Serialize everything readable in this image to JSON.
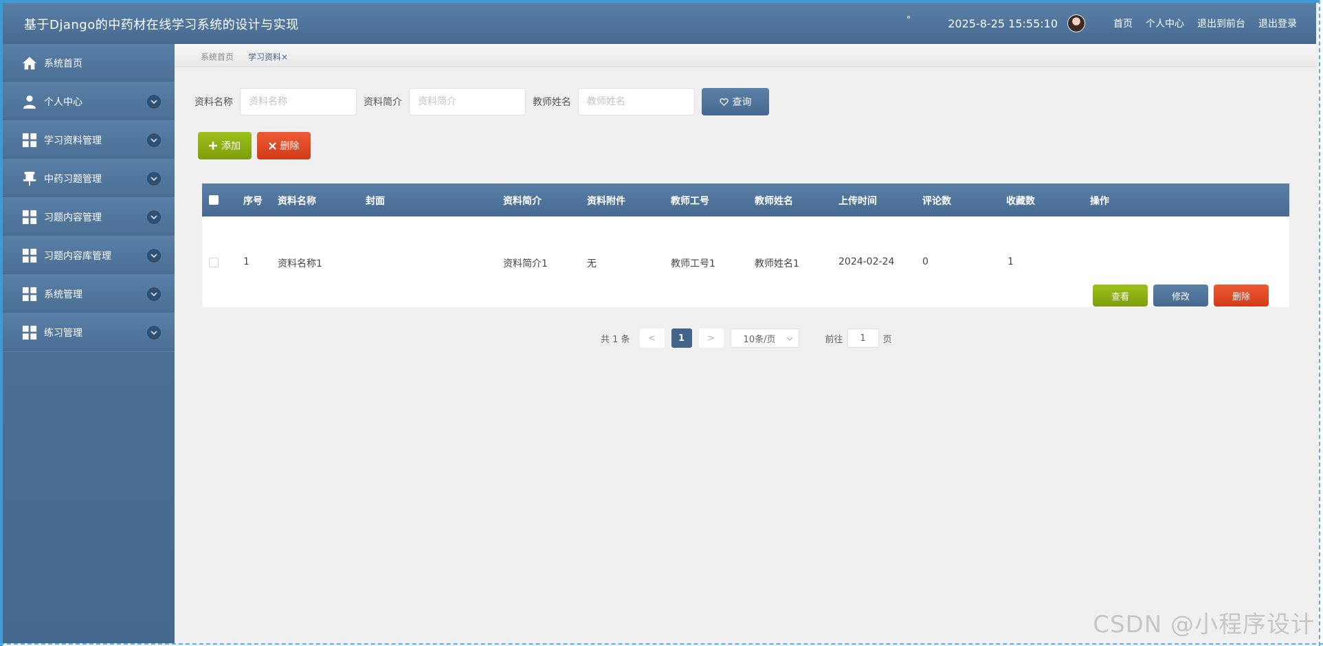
{
  "header": {
    "title": "基于Django的中药材在线学习系统的设计与实现",
    "degree": "°",
    "datetime": "2025-8-25 15:55:10",
    "links": [
      "首页",
      "个人中心",
      "退出到前台",
      "退出登录"
    ]
  },
  "sidebar": {
    "items": [
      {
        "label": "系统首页",
        "icon": "home-icon"
      },
      {
        "label": "个人中心",
        "icon": "person-icon"
      },
      {
        "label": "学习资料管理",
        "icon": "grid-icon"
      },
      {
        "label": "中药习题管理",
        "icon": "pin-icon"
      },
      {
        "label": "习题内容管理",
        "icon": "grid-icon"
      },
      {
        "label": "习题内容库管理",
        "icon": "grid-icon"
      },
      {
        "label": "系统管理",
        "icon": "grid-icon"
      },
      {
        "label": "练习管理",
        "icon": "grid-icon"
      }
    ]
  },
  "breadcrumb": {
    "home": "系统首页",
    "current": "学习资料",
    "close": "×"
  },
  "search": {
    "name_label": "资料名称",
    "name_placeholder": "资料名称",
    "intro_label": "资料简介",
    "intro_placeholder": "资料简介",
    "teacher_label": "教师姓名",
    "teacher_placeholder": "教师姓名",
    "query_label": "查询"
  },
  "actions": {
    "add_label": "添加",
    "delete_label": "删除"
  },
  "table": {
    "headers": [
      "序号",
      "资料名称",
      "封面",
      "资料简介",
      "资料附件",
      "教师工号",
      "教师姓名",
      "上传时间",
      "评论数",
      "收藏数",
      "操作"
    ],
    "rows": [
      {
        "index": "1",
        "name": "资料名称1",
        "cover": "",
        "intro": "资料简介1",
        "attachment": "无",
        "teacher_id": "教师工号1",
        "teacher_name": "教师姓名1",
        "upload_time": "2024-02-24",
        "comments": "0",
        "favorites": "1",
        "view_label": "查看",
        "edit_label": "修改",
        "delete_label": "删除"
      }
    ]
  },
  "pagination": {
    "total_text": "共 1 条",
    "prev": "<",
    "current_page": "1",
    "next": ">",
    "page_size": "10条/页",
    "goto_label": "前往",
    "goto_value": "1",
    "page_suffix": "页"
  },
  "watermark": "CSDN @小程序设计",
  "colors": {
    "primary": "#46698f",
    "success": "#8db012",
    "danger": "#e04a26",
    "background": "#f0f0f0"
  }
}
